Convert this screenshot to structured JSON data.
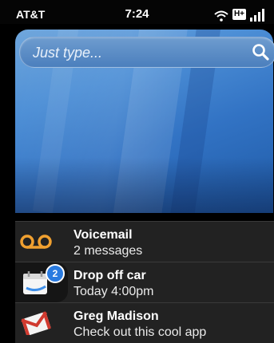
{
  "status_bar": {
    "carrier": "AT&T",
    "time": "7:24",
    "network": "H+"
  },
  "search": {
    "placeholder": "Just type..."
  },
  "notifications": [
    {
      "title": "Voicemail",
      "subtitle": "2 messages",
      "icon": "voicemail-icon",
      "color": "#f0a030"
    },
    {
      "title": "Drop off car",
      "subtitle": "Today 4:00pm",
      "icon": "calendar-icon",
      "badge": "2",
      "badge_color": "#2a7be0"
    },
    {
      "title": "Greg Madison",
      "subtitle": "Check out this cool app",
      "icon": "gmail-icon",
      "color": "#d03a2f"
    }
  ]
}
